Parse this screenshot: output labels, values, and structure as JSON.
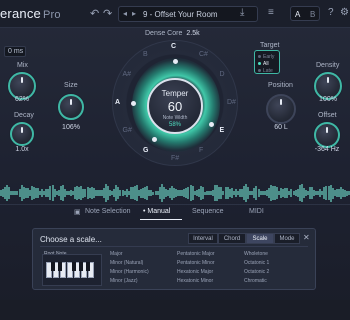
{
  "app": {
    "logo": "erance",
    "logo_suffix": "Pro"
  },
  "toolbar": {
    "undo": "↶",
    "redo": "↷",
    "preset_prev": "◂",
    "preset_next": "▸",
    "preset_name": "9 - Offset Your Room",
    "save_icon": "⤓",
    "menu_icon": "≡",
    "a_label": "A",
    "b_label": "B",
    "help_icon": "?",
    "settings_icon": "⚙"
  },
  "left": {
    "ms_value": "0 ms",
    "mix_label": "Mix",
    "mix_value": "62%",
    "size_label": "Size",
    "size_value": "106%",
    "decay_label": "Decay",
    "decay_value": "1.0x"
  },
  "center": {
    "dense_label": "Dense Core",
    "dense_value": "2.5k",
    "title": "Temper",
    "value": "60",
    "sub_label": "Note Width",
    "sub_value": "58%",
    "notes": [
      "C",
      "C#",
      "D",
      "D#",
      "E",
      "F",
      "F#",
      "G",
      "G#",
      "A",
      "A#",
      "B"
    ],
    "active_notes": [
      "C",
      "E",
      "G",
      "A"
    ]
  },
  "right": {
    "target_label": "Target",
    "target_options": [
      "Early",
      "All",
      "Late"
    ],
    "target_selected": "All",
    "position_label": "Position",
    "position_value": "60 L",
    "density_label": "Density",
    "density_value": "100%",
    "offset_label": "Offset",
    "offset_value": "-364 Hz"
  },
  "tabs": {
    "note_selection": "Note Selection",
    "manual": "Manual",
    "sequence": "Sequence",
    "midi": "MIDI"
  },
  "scale_panel": {
    "title": "Choose a scale...",
    "modes": [
      "Interval",
      "Chord",
      "Scale",
      "Mode"
    ],
    "active_mode": "Scale",
    "close": "✕",
    "root_label": "Root Note",
    "key_labels": [
      "C",
      "D",
      "E",
      "F",
      "G",
      "A",
      "B"
    ],
    "col1": [
      "Major",
      "Minor (Natural)",
      "Minor (Harmonic)",
      "Minor (Jazz)"
    ],
    "col2": [
      "Pentatonic Major",
      "Pentatonic Minor",
      "Hexatonic Major",
      "Hexatonic Minor"
    ],
    "col3": [
      "Wholetone",
      "Octatonic 1",
      "Octatonic 2",
      "Chromatic"
    ]
  }
}
